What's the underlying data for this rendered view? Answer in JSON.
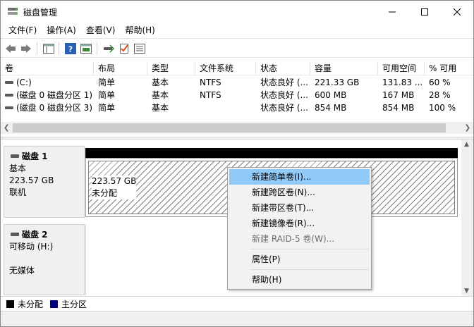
{
  "window": {
    "title": "磁盘管理"
  },
  "menu": [
    "文件(F)",
    "操作(A)",
    "查看(V)",
    "帮助(H)"
  ],
  "volume_list": {
    "columns": [
      "卷",
      "布局",
      "类型",
      "文件系统",
      "状态",
      "容量",
      "可用空间",
      "% 可用"
    ],
    "rows": [
      [
        "(C:)",
        "简单",
        "基本",
        "NTFS",
        "状态良好 (...",
        "221.33 GB",
        "131.83 ...",
        "60 %"
      ],
      [
        "(磁盘 0 磁盘分区 1)",
        "简单",
        "基本",
        "NTFS",
        "状态良好 (...",
        "600 MB",
        "167 MB",
        "28 %"
      ],
      [
        "(磁盘 0 磁盘分区 3)",
        "简单",
        "基本",
        "",
        "状态良好 (...",
        "854 MB",
        "854 MB",
        "100 %"
      ]
    ]
  },
  "disks": [
    {
      "name": "磁盘 1",
      "type": "基本",
      "size": "223.57 GB",
      "status": "联机",
      "partition": {
        "size": "223.57 GB",
        "status": "未分配"
      }
    },
    {
      "name": "磁盘 2",
      "type": "可移动 (H:)",
      "status": "无媒体"
    }
  ],
  "legend": [
    {
      "label": "未分配",
      "color": "#000000"
    },
    {
      "label": "主分区",
      "color": "#000080"
    }
  ],
  "context_menu": {
    "items": [
      {
        "label": "新建简单卷(I)...",
        "highlighted": true,
        "disabled": false
      },
      {
        "label": "新建跨区卷(N)...",
        "highlighted": false,
        "disabled": false
      },
      {
        "label": "新建带区卷(T)...",
        "highlighted": false,
        "disabled": false
      },
      {
        "label": "新建镜像卷(R)...",
        "highlighted": false,
        "disabled": false
      },
      {
        "label": "新建 RAID-5 卷(W)...",
        "highlighted": false,
        "disabled": true
      }
    ],
    "properties": "属性(P)",
    "help": "帮助(H)"
  },
  "colors": {
    "highlight": "#91c9f7",
    "unallocated_bar": "#000000",
    "primary_partition": "#000080"
  }
}
